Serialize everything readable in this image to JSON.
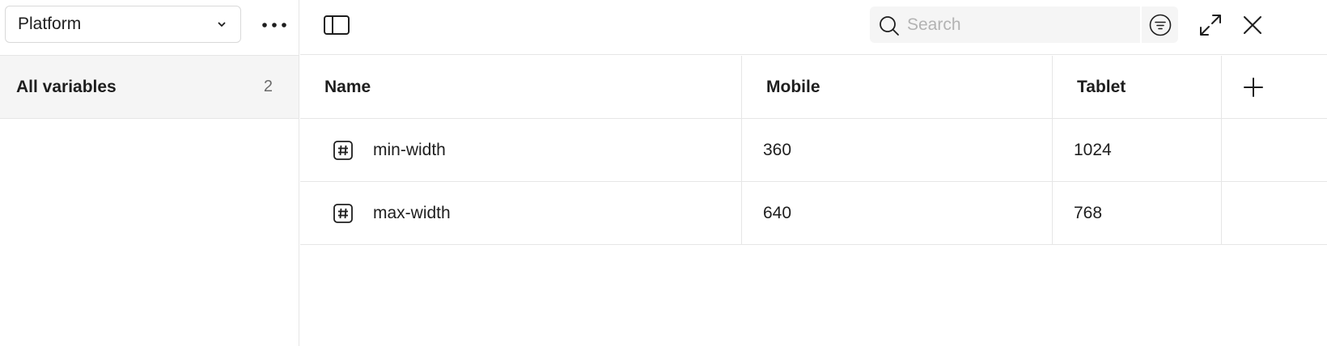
{
  "left_panel": {
    "collection": {
      "selected": "Platform"
    },
    "groups": [
      {
        "label": "All variables",
        "count": "2"
      }
    ]
  },
  "toolbar": {
    "search": {
      "placeholder": "Search",
      "value": ""
    }
  },
  "table": {
    "columns": [
      "Name",
      "Mobile",
      "Tablet"
    ],
    "rows": [
      {
        "icon": "number-variable-icon",
        "name": "min-width",
        "mobile": "360",
        "tablet": "1024"
      },
      {
        "icon": "number-variable-icon",
        "name": "max-width",
        "mobile": "640",
        "tablet": "768"
      }
    ]
  },
  "colors": {
    "text": "#1e1e1e",
    "muted": "#6b6b6b",
    "border": "#e6e6e6",
    "selected_bg": "#f5f5f5",
    "placeholder": "#b3b3b3"
  }
}
